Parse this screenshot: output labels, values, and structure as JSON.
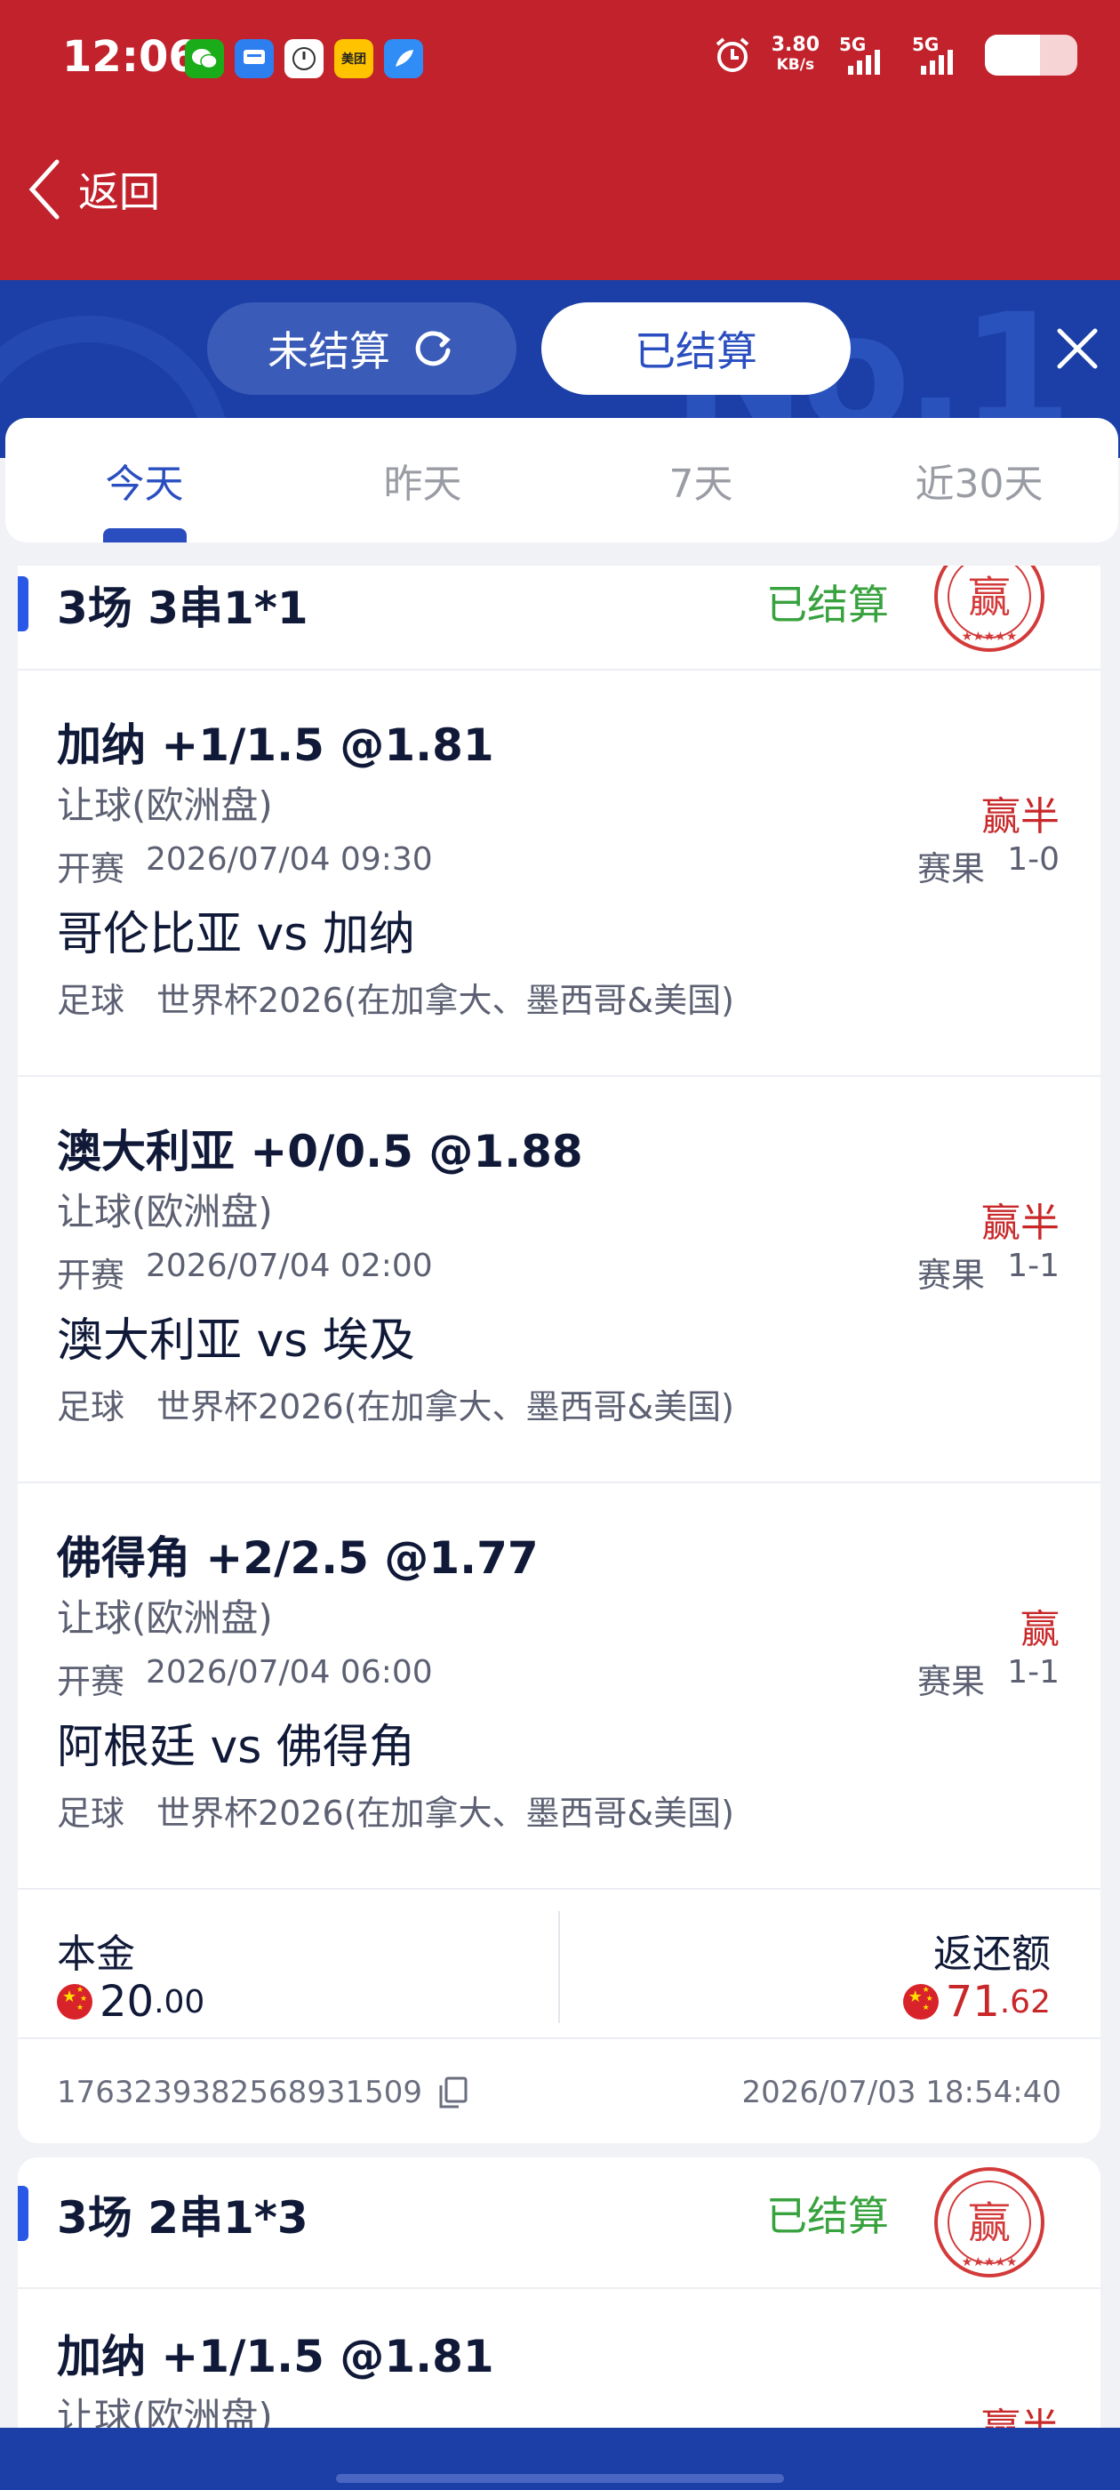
{
  "status_bar": {
    "time": "12:06",
    "apps": [
      {
        "icon": "wechat-icon",
        "color": "#1aad19",
        "text": ""
      },
      {
        "icon": "message-icon",
        "color": "#2d7ff0",
        "text": ""
      },
      {
        "icon": "clock-app-icon",
        "color": "#ffffff",
        "text": ""
      },
      {
        "icon": "meituan-icon",
        "color": "#ffc300",
        "text": "美团"
      },
      {
        "icon": "feather-app-icon",
        "color": "#2f8df5",
        "text": ""
      }
    ],
    "net_speed": "3.80",
    "net_unit": "KB/s",
    "sig1_label": "5G",
    "sig2_label": "5G",
    "battery_level": 0.6
  },
  "header": {
    "back_label": "返回"
  },
  "segment": {
    "pending_label": "未结算",
    "settled_label": "已结算",
    "active": "settled"
  },
  "tabs": [
    {
      "label": "今天",
      "active": true
    },
    {
      "label": "昨天",
      "active": false
    },
    {
      "label": "7天",
      "active": false
    },
    {
      "label": "近30天",
      "active": false
    }
  ],
  "bets": [
    {
      "title": "3场 3串1*1",
      "status": "已结算",
      "stamp": "赢",
      "legs": [
        {
          "selection": "加纳 +1/1.5 @1.81",
          "market": "让球(欧洲盘)",
          "result": "赢半",
          "start_label": "开赛",
          "start_time": "2026/07/04 09:30",
          "score_label": "赛果",
          "score": "1-0",
          "match": "哥伦比亚 vs 加纳",
          "sport": "足球",
          "league": "世界杯2026(在加拿大、墨西哥&美国)"
        },
        {
          "selection": "澳大利亚 +0/0.5 @1.88",
          "market": "让球(欧洲盘)",
          "result": "赢半",
          "start_label": "开赛",
          "start_time": "2026/07/04 02:00",
          "score_label": "赛果",
          "score": "1-1",
          "match": "澳大利亚 vs 埃及",
          "sport": "足球",
          "league": "世界杯2026(在加拿大、墨西哥&美国)"
        },
        {
          "selection": "佛得角 +2/2.5 @1.77",
          "market": "让球(欧洲盘)",
          "result": "赢",
          "start_label": "开赛",
          "start_time": "2026/07/04 06:00",
          "score_label": "赛果",
          "score": "1-1",
          "match": "阿根廷 vs 佛得角",
          "sport": "足球",
          "league": "世界杯2026(在加拿大、墨西哥&美国)"
        }
      ],
      "stake_label": "本金",
      "stake_int": "20",
      "stake_dec": ".00",
      "return_label": "返还额",
      "return_int": "71",
      "return_dec": ".62",
      "order_id": "1763239382568931509",
      "order_time": "2026/07/03 18:54:40"
    },
    {
      "title": "3场 2串1*3",
      "status": "已结算",
      "stamp": "赢",
      "legs": [
        {
          "selection": "加纳 +1/1.5 @1.81",
          "market": "让球(欧洲盘)",
          "result": "赢半"
        }
      ]
    }
  ]
}
